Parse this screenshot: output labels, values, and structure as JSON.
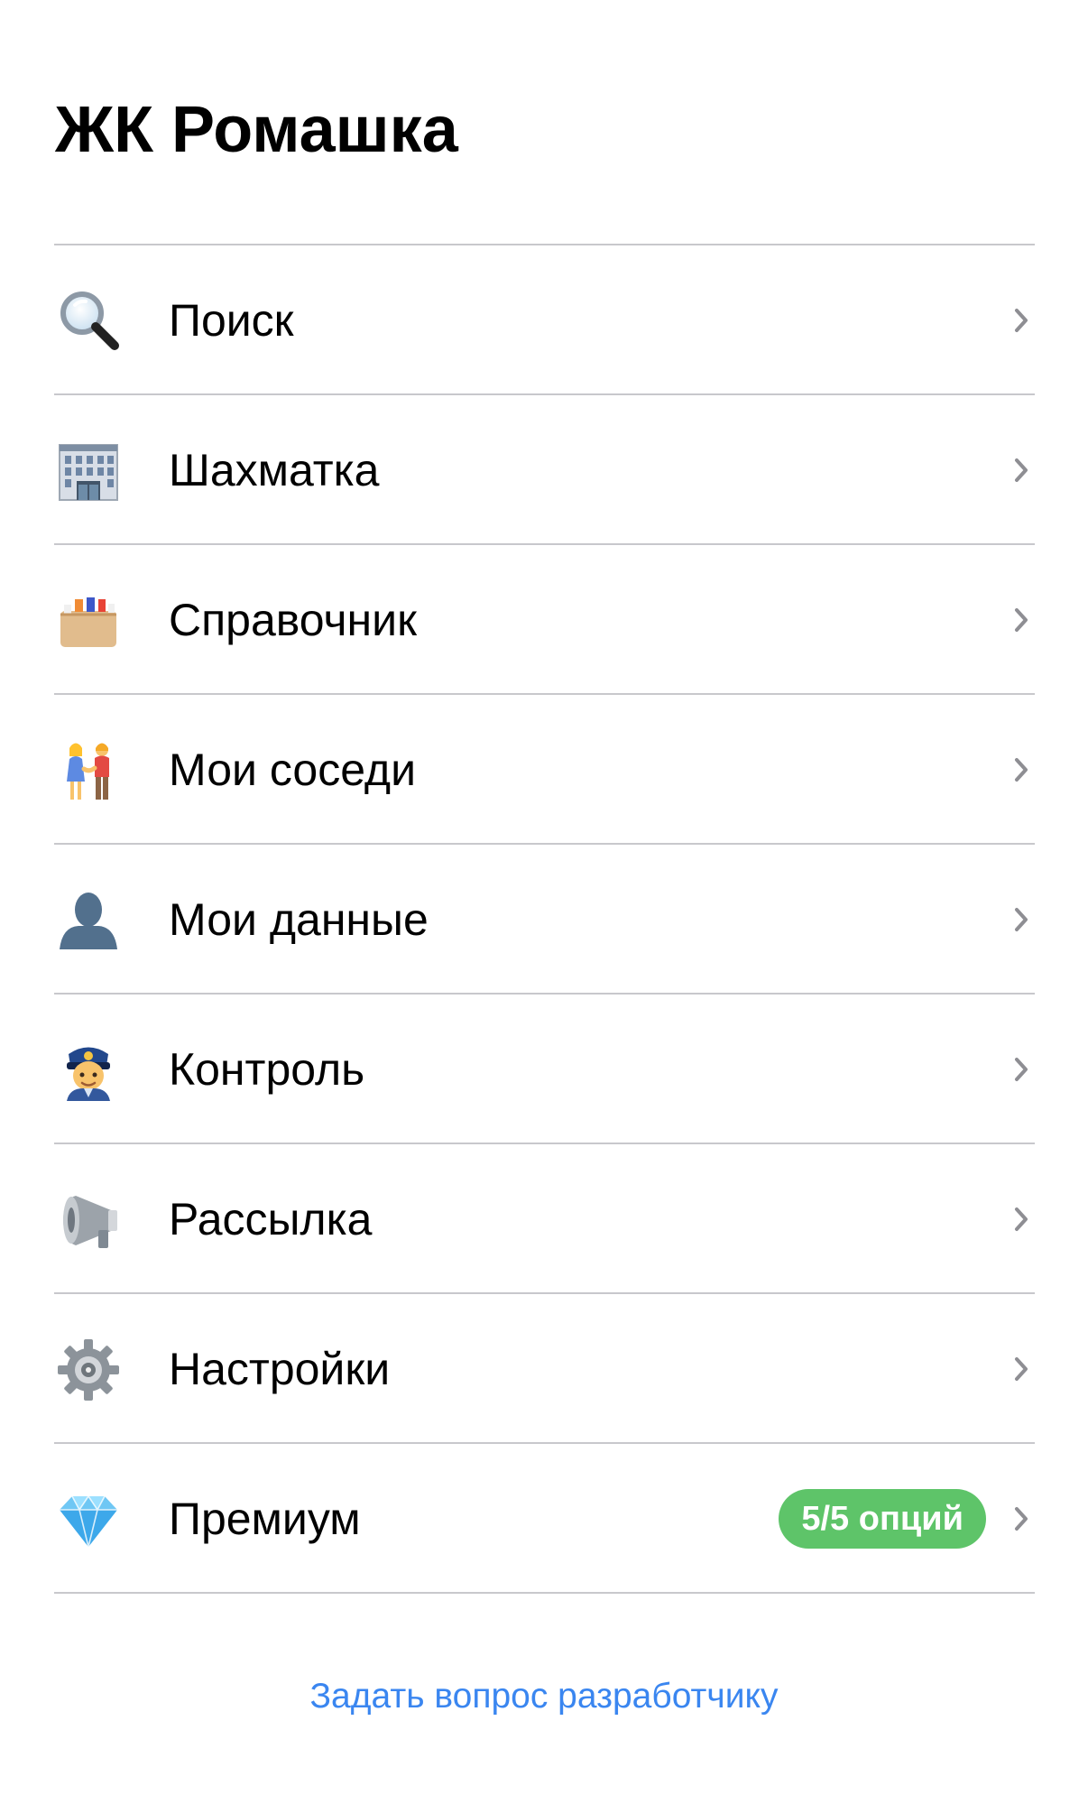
{
  "header": {
    "title": "ЖК Ромашка"
  },
  "menu": {
    "items": [
      {
        "label": "Поиск",
        "icon": "magnifying-glass-icon"
      },
      {
        "label": "Шахматка",
        "icon": "office-building-icon"
      },
      {
        "label": "Справочник",
        "icon": "card-file-box-icon"
      },
      {
        "label": "Мои соседи",
        "icon": "couple-holding-hands-icon"
      },
      {
        "label": "Мои данные",
        "icon": "user-silhouette-icon"
      },
      {
        "label": "Контроль",
        "icon": "police-officer-icon"
      },
      {
        "label": "Рассылка",
        "icon": "megaphone-icon"
      },
      {
        "label": "Настройки",
        "icon": "gear-icon"
      },
      {
        "label": "Премиум",
        "icon": "gem-icon",
        "badge": "5/5 опций"
      }
    ]
  },
  "footer": {
    "link_label": "Задать вопрос разработчику"
  },
  "colors": {
    "accent": "#3a86f0",
    "badge": "#5ec469",
    "separator": "#c8c8cc",
    "chevron": "#8e8e93"
  }
}
